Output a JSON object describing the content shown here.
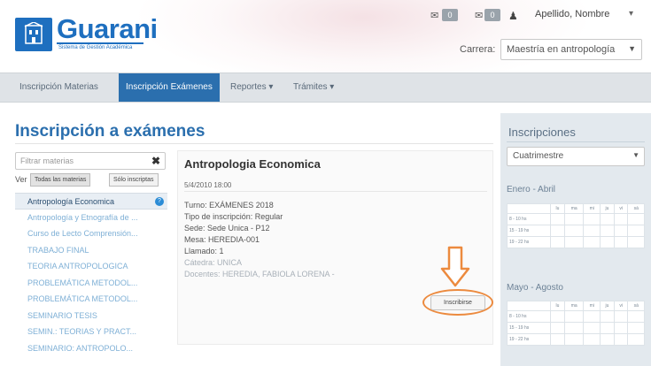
{
  "brand": {
    "name": "Guarani",
    "subtitle": "Sistema de Gestión Académica",
    "color": "#1e6fbf"
  },
  "header": {
    "messages_count": "0",
    "notifications_count": "0",
    "user_name": "Apellido, Nombre",
    "carrera_label": "Carrera:",
    "carrera_value": "Maestría en antropología"
  },
  "nav": {
    "items": [
      {
        "label": "Inscripción Materias"
      },
      {
        "label": "Inscripción Exámenes"
      },
      {
        "label": "Reportes ▾"
      },
      {
        "label": "Trámites ▾"
      }
    ]
  },
  "page": {
    "title": "Inscripción a exámenes"
  },
  "filter": {
    "placeholder": "Filtrar materias",
    "ver_label": "Ver",
    "toggle_all": "Todas las materias",
    "toggle_mine": "Sólo inscriptas"
  },
  "subjects": [
    "Antropología Economica",
    "Antropología y Etnografía de ...",
    "Curso de Lecto Comprensión...",
    "TRABAJO FINAL",
    "TEORIA ANTROPOLOGICA",
    "PROBLEMÁTICA METODOL...",
    "PROBLEMÁTICA METODOL...",
    "SEMINARIO TESIS",
    "SEMIN.: TEORIAS Y PRACT...",
    "SEMINARIO: ANTROPOLO..."
  ],
  "exam": {
    "title": "Antropologia Economica",
    "date": "5/4/2010 18:00",
    "turno": "Turno: EXÁMENES 2018",
    "tipo": "Tipo de inscripción: Regular",
    "sede": "Sede: Sede Unica - P12",
    "mesa": "Mesa: HEREDIA-001",
    "llamado": "Llamado: 1",
    "catedra": "Cátedra: UNICA",
    "docentes": "Docentes: HEREDIA, FABIOLA LORENA -",
    "button": "Inscribirse"
  },
  "sidebar": {
    "title": "Inscripciones",
    "period_select": "Cuatrimestre",
    "section1": "Enero - Abril",
    "section2": "Mayo - Agosto",
    "weekdays": [
      "lu",
      "ma",
      "mi",
      "ju",
      "vi",
      "sá"
    ],
    "rows1": [
      "8 - 10 hs",
      "15 - 19 hs",
      "19 - 22 hs"
    ],
    "rows2": [
      "8 - 10 hs",
      "15 - 19 hs",
      "19 - 22 hs"
    ]
  },
  "colors": {
    "accent": "#2b6fae",
    "highlight": "#ec8a3e"
  }
}
